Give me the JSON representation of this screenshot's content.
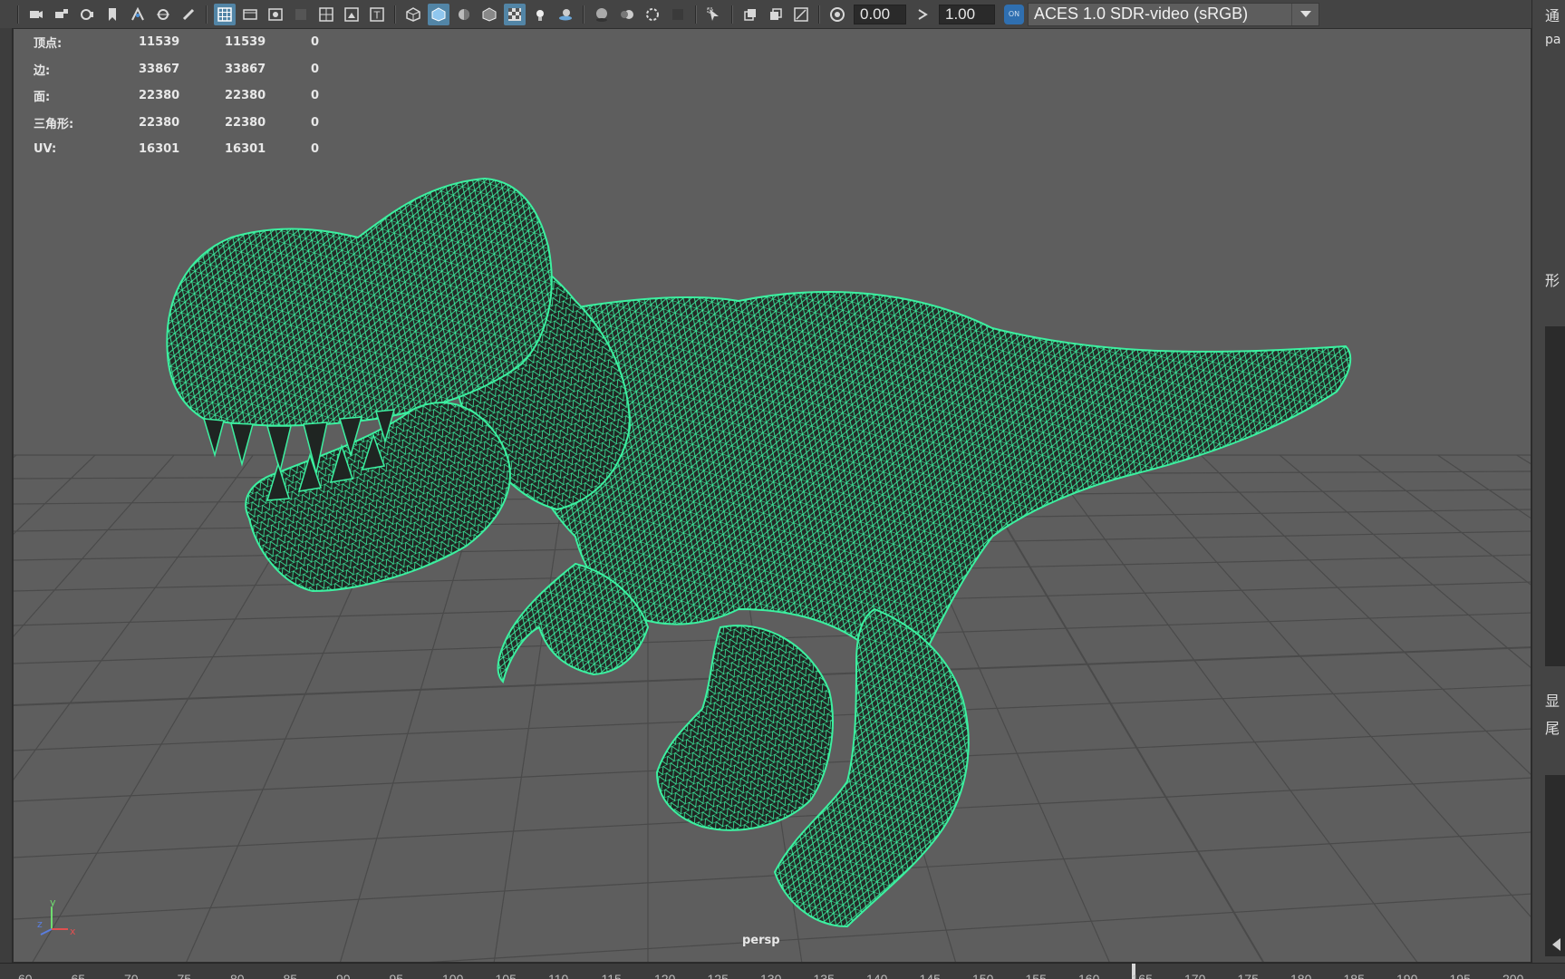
{
  "toolbar": {
    "exposure_value": "0.00",
    "gamma_value": "1.00",
    "on_badge": "ON",
    "colorspace_selected": "ACES 1.0 SDR-video (sRGB)"
  },
  "hud": {
    "rows": [
      {
        "label": "顶点:",
        "v1": "11539",
        "v2": "11539",
        "v3": "0"
      },
      {
        "label": "边:",
        "v1": "33867",
        "v2": "33867",
        "v3": "0"
      },
      {
        "label": "面:",
        "v1": "22380",
        "v2": "22380",
        "v3": "0"
      },
      {
        "label": "三角形:",
        "v1": "22380",
        "v2": "22380",
        "v3": "0"
      },
      {
        "label": "UV:",
        "v1": "16301",
        "v2": "16301",
        "v3": "0"
      }
    ]
  },
  "viewport": {
    "camera_label": "persp",
    "wire_color": "#3cf0a0",
    "background_color": "#5e5e5e",
    "grid_color": "#4a4a4a"
  },
  "axis": {
    "x": "x",
    "y": "y",
    "z": "z"
  },
  "right_panel": {
    "t1": "通",
    "t2": "pa",
    "t3": "形",
    "t4": "显",
    "t5": "尾"
  },
  "timeline": {
    "ticks": [
      "60",
      "65",
      "70",
      "75",
      "80",
      "85",
      "90",
      "95",
      "100",
      "105",
      "110",
      "115",
      "120",
      "125",
      "130",
      "135",
      "140",
      "145",
      "150",
      "155",
      "160",
      "165",
      "170",
      "175",
      "180",
      "185",
      "190",
      "195",
      "200"
    ]
  }
}
